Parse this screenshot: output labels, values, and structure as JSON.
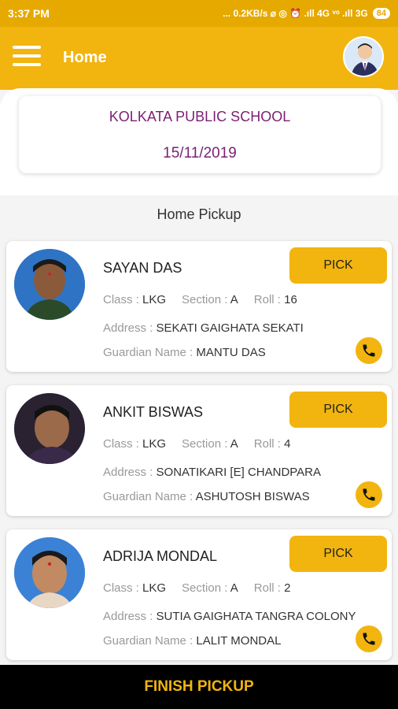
{
  "status_bar": {
    "time": "3:37 PM",
    "right": "... 0.2KB/s ⌀ ◎ ⏰ .ıll 4G ᵛᵒ .ıll 3G",
    "battery": "84"
  },
  "app_bar": {
    "title": "Home"
  },
  "school": {
    "name": "KOLKATA PUBLIC SCHOOL",
    "date": "15/11/2019"
  },
  "section_title": "Home Pickup",
  "labels": {
    "class": "Class : ",
    "section": "Section : ",
    "roll": "Roll : ",
    "address": "Address : ",
    "guardian": "Guardian Name : ",
    "pick": "PICK"
  },
  "students": [
    {
      "name": "SAYAN DAS",
      "class": "LKG",
      "section": "A",
      "roll": "16",
      "address": "SEKATI GAIGHATA SEKATI",
      "guardian": "MANTU DAS"
    },
    {
      "name": "ANKIT BISWAS",
      "class": "LKG",
      "section": "A",
      "roll": "4",
      "address": "SONATIKARI [E]  CHANDPARA",
      "guardian": "ASHUTOSH BISWAS"
    },
    {
      "name": "ADRIJA MONDAL",
      "class": "LKG",
      "section": "A",
      "roll": "2",
      "address": "SUTIA GAIGHATA TANGRA COLONY",
      "guardian": "LALIT MONDAL"
    }
  ],
  "finish_label": "FINISH PICKUP",
  "colors": {
    "accent": "#f2b40f",
    "school_text": "#7a1f74"
  }
}
